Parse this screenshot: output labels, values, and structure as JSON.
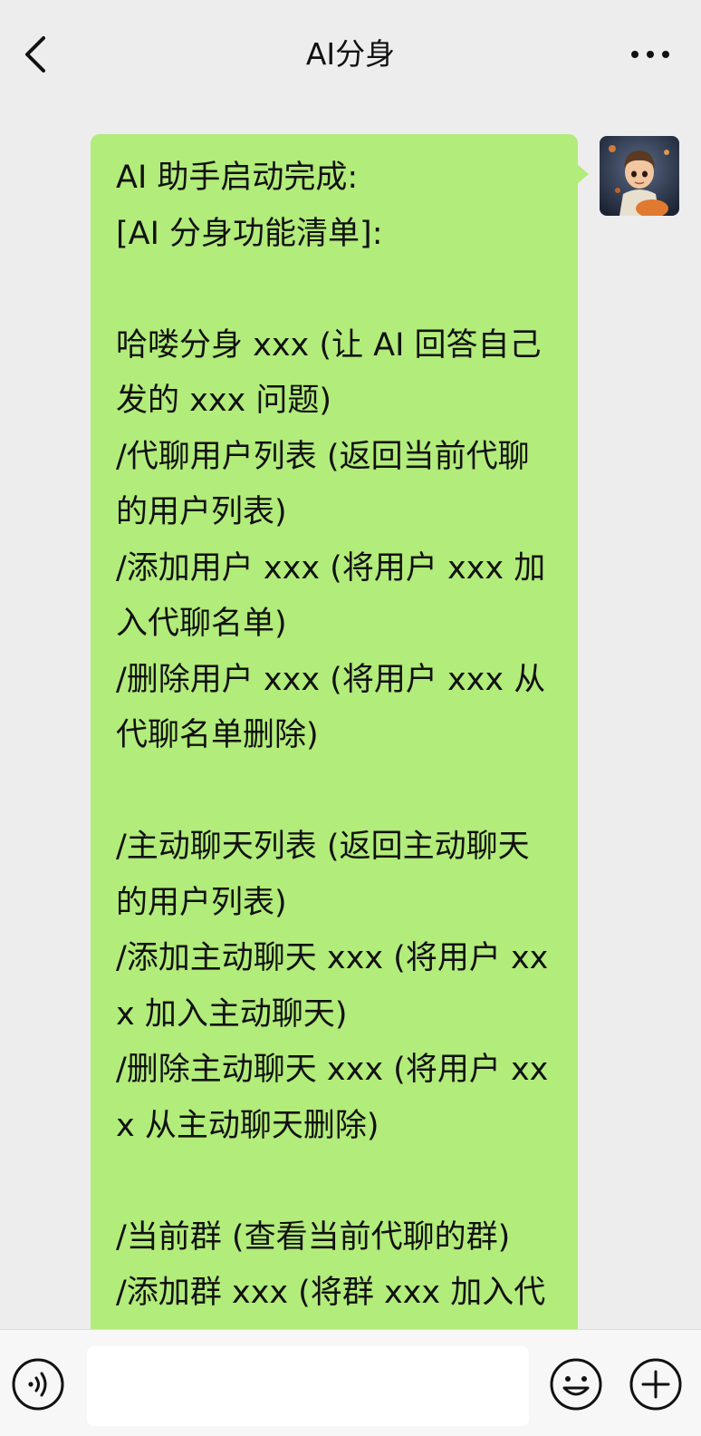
{
  "header": {
    "title": "AI分身",
    "back_icon": "chevron-left-icon",
    "more_icon": "more-dots-icon"
  },
  "message": {
    "sender": "self",
    "text": "AI 助手启动完成:\n[AI 分身功能清单]:\n\n哈喽分身 xxx (让 AI 回答自己发的 xxx 问题)\n/代聊用户列表 (返回当前代聊的用户列表)\n/添加用户 xxx (将用户 xxx 加入代聊名单)\n/删除用户 xxx (将用户 xxx 从代聊名单删除)\n\n/主动聊天列表 (返回主动聊天的用户列表)\n/添加主动聊天 xxx (将用户 xxx 加入主动聊天)\n/删除主动聊天 xxx (将用户 xxx 从主动聊天删除)\n\n/当前群 (查看当前代聊的群)\n/添加群 xxx (将群 xxx 加入代聊)",
    "bubble_color": "#b2ec7a"
  },
  "input_bar": {
    "voice_icon": "voice-icon",
    "input_value": "",
    "emoji_icon": "emoji-icon",
    "plus_icon": "plus-circle-icon"
  },
  "colors": {
    "background": "#ededed",
    "bubble": "#b2ec7a",
    "bottom_bar": "#f7f7f7"
  }
}
